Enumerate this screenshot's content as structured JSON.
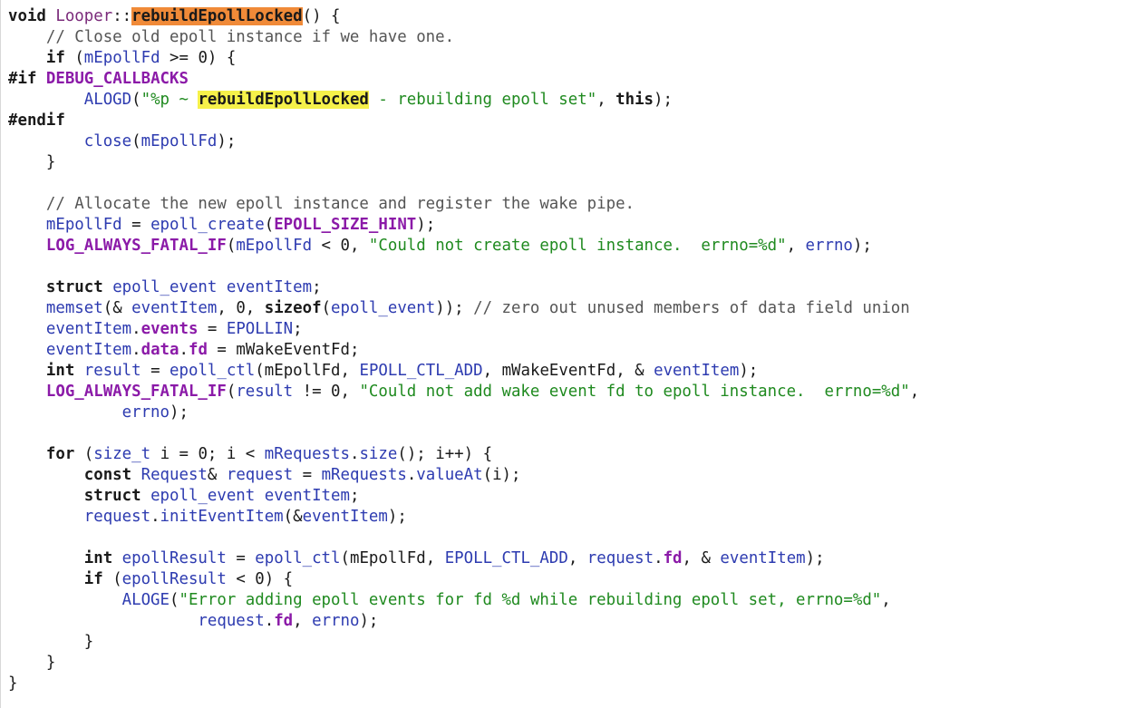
{
  "colors": {
    "plain": "#1a1a1a",
    "identifier": "#2d3bb0",
    "macro_member": "#8b1aa8",
    "string": "#1f8a1f",
    "comment": "#555555",
    "highlight_primary": "#f08a38",
    "highlight_secondary": "#f6f14a"
  },
  "lines": [
    {
      "tokens": [
        {
          "t": "void ",
          "c": "kw"
        },
        {
          "t": "Looper",
          "c": "cls"
        },
        {
          "t": "::",
          "c": "plain"
        },
        {
          "t": "rebuildEpollLocked",
          "c": "hl-orange"
        },
        {
          "t": "() {",
          "c": "plain"
        }
      ]
    },
    {
      "tokens": [
        {
          "t": "    // Close old epoll instance if we have one.",
          "c": "cmt"
        }
      ]
    },
    {
      "tokens": [
        {
          "t": "    ",
          "c": "plain"
        },
        {
          "t": "if",
          "c": "kw"
        },
        {
          "t": " (",
          "c": "plain"
        },
        {
          "t": "mEpollFd",
          "c": "ident"
        },
        {
          "t": " >= 0) {",
          "c": "plain"
        }
      ]
    },
    {
      "tokens": [
        {
          "t": "#if",
          "c": "pre"
        },
        {
          "t": " ",
          "c": "plain"
        },
        {
          "t": "DEBUG_CALLBACKS",
          "c": "macro"
        }
      ]
    },
    {
      "tokens": [
        {
          "t": "        ",
          "c": "plain"
        },
        {
          "t": "ALOGD",
          "c": "ident"
        },
        {
          "t": "(",
          "c": "plain"
        },
        {
          "t": "\"%p ~ ",
          "c": "str"
        },
        {
          "t": "rebuildEpollLocked",
          "c": "hl-yellow"
        },
        {
          "t": " - rebuilding epoll set\"",
          "c": "str"
        },
        {
          "t": ", ",
          "c": "plain"
        },
        {
          "t": "this",
          "c": "kw"
        },
        {
          "t": ");",
          "c": "plain"
        }
      ]
    },
    {
      "tokens": [
        {
          "t": "#endif",
          "c": "pre"
        }
      ]
    },
    {
      "tokens": [
        {
          "t": "        ",
          "c": "plain"
        },
        {
          "t": "close",
          "c": "ident"
        },
        {
          "t": "(",
          "c": "plain"
        },
        {
          "t": "mEpollFd",
          "c": "ident"
        },
        {
          "t": ");",
          "c": "plain"
        }
      ]
    },
    {
      "tokens": [
        {
          "t": "    }",
          "c": "plain"
        }
      ]
    },
    {
      "tokens": []
    },
    {
      "tokens": [
        {
          "t": "    // Allocate the new epoll instance and register the wake pipe.",
          "c": "cmt"
        }
      ]
    },
    {
      "tokens": [
        {
          "t": "    ",
          "c": "plain"
        },
        {
          "t": "mEpollFd",
          "c": "ident"
        },
        {
          "t": " = ",
          "c": "plain"
        },
        {
          "t": "epoll_create",
          "c": "ident"
        },
        {
          "t": "(",
          "c": "plain"
        },
        {
          "t": "EPOLL_SIZE_HINT",
          "c": "macro"
        },
        {
          "t": ");",
          "c": "plain"
        }
      ]
    },
    {
      "tokens": [
        {
          "t": "    ",
          "c": "plain"
        },
        {
          "t": "LOG_ALWAYS_FATAL_IF",
          "c": "macro"
        },
        {
          "t": "(",
          "c": "plain"
        },
        {
          "t": "mEpollFd",
          "c": "ident"
        },
        {
          "t": " < 0, ",
          "c": "plain"
        },
        {
          "t": "\"Could not create epoll instance.  errno=%d\"",
          "c": "str"
        },
        {
          "t": ", ",
          "c": "plain"
        },
        {
          "t": "errno",
          "c": "ident"
        },
        {
          "t": ");",
          "c": "plain"
        }
      ]
    },
    {
      "tokens": []
    },
    {
      "tokens": [
        {
          "t": "    ",
          "c": "plain"
        },
        {
          "t": "struct",
          "c": "kw"
        },
        {
          "t": " ",
          "c": "plain"
        },
        {
          "t": "epoll_event",
          "c": "type"
        },
        {
          "t": " ",
          "c": "plain"
        },
        {
          "t": "eventItem",
          "c": "ident"
        },
        {
          "t": ";",
          "c": "plain"
        }
      ]
    },
    {
      "tokens": [
        {
          "t": "    ",
          "c": "plain"
        },
        {
          "t": "memset",
          "c": "ident"
        },
        {
          "t": "(& ",
          "c": "plain"
        },
        {
          "t": "eventItem",
          "c": "ident"
        },
        {
          "t": ", 0, ",
          "c": "plain"
        },
        {
          "t": "sizeof",
          "c": "kw"
        },
        {
          "t": "(",
          "c": "plain"
        },
        {
          "t": "epoll_event",
          "c": "type"
        },
        {
          "t": ")); ",
          "c": "plain"
        },
        {
          "t": "// zero out unused members of data field union",
          "c": "cmt"
        }
      ]
    },
    {
      "tokens": [
        {
          "t": "    ",
          "c": "plain"
        },
        {
          "t": "eventItem",
          "c": "ident"
        },
        {
          "t": ".",
          "c": "plain"
        },
        {
          "t": "events",
          "c": "member"
        },
        {
          "t": " = ",
          "c": "plain"
        },
        {
          "t": "EPOLLIN",
          "c": "ident"
        },
        {
          "t": ";",
          "c": "plain"
        }
      ]
    },
    {
      "tokens": [
        {
          "t": "    ",
          "c": "plain"
        },
        {
          "t": "eventItem",
          "c": "ident"
        },
        {
          "t": ".",
          "c": "plain"
        },
        {
          "t": "data",
          "c": "member"
        },
        {
          "t": ".",
          "c": "plain"
        },
        {
          "t": "fd",
          "c": "member"
        },
        {
          "t": " = ",
          "c": "plain"
        },
        {
          "t": "mWakeEventFd",
          "c": "plain"
        },
        {
          "t": ";",
          "c": "plain"
        }
      ]
    },
    {
      "tokens": [
        {
          "t": "    ",
          "c": "plain"
        },
        {
          "t": "int",
          "c": "kw"
        },
        {
          "t": " ",
          "c": "plain"
        },
        {
          "t": "result",
          "c": "ident"
        },
        {
          "t": " = ",
          "c": "plain"
        },
        {
          "t": "epoll_ctl",
          "c": "ident"
        },
        {
          "t": "(",
          "c": "plain"
        },
        {
          "t": "mEpollFd",
          "c": "plain"
        },
        {
          "t": ", ",
          "c": "plain"
        },
        {
          "t": "EPOLL_CTL_ADD",
          "c": "ident"
        },
        {
          "t": ", ",
          "c": "plain"
        },
        {
          "t": "mWakeEventFd",
          "c": "plain"
        },
        {
          "t": ", & ",
          "c": "plain"
        },
        {
          "t": "eventItem",
          "c": "ident"
        },
        {
          "t": ");",
          "c": "plain"
        }
      ]
    },
    {
      "tokens": [
        {
          "t": "    ",
          "c": "plain"
        },
        {
          "t": "LOG_ALWAYS_FATAL_IF",
          "c": "macro"
        },
        {
          "t": "(",
          "c": "plain"
        },
        {
          "t": "result",
          "c": "ident"
        },
        {
          "t": " != 0, ",
          "c": "plain"
        },
        {
          "t": "\"Could not add wake event fd to epoll instance.  errno=%d\"",
          "c": "str"
        },
        {
          "t": ",",
          "c": "plain"
        }
      ]
    },
    {
      "tokens": [
        {
          "t": "            ",
          "c": "plain"
        },
        {
          "t": "errno",
          "c": "ident"
        },
        {
          "t": ");",
          "c": "plain"
        }
      ]
    },
    {
      "tokens": []
    },
    {
      "tokens": [
        {
          "t": "    ",
          "c": "plain"
        },
        {
          "t": "for",
          "c": "kw"
        },
        {
          "t": " (",
          "c": "plain"
        },
        {
          "t": "size_t",
          "c": "type"
        },
        {
          "t": " i = 0; i < ",
          "c": "plain"
        },
        {
          "t": "mRequests",
          "c": "ident"
        },
        {
          "t": ".",
          "c": "plain"
        },
        {
          "t": "size",
          "c": "ident"
        },
        {
          "t": "(); i++) {",
          "c": "plain"
        }
      ]
    },
    {
      "tokens": [
        {
          "t": "        ",
          "c": "plain"
        },
        {
          "t": "const",
          "c": "kw"
        },
        {
          "t": " ",
          "c": "plain"
        },
        {
          "t": "Request",
          "c": "type"
        },
        {
          "t": "& ",
          "c": "plain"
        },
        {
          "t": "request",
          "c": "ident"
        },
        {
          "t": " = ",
          "c": "plain"
        },
        {
          "t": "mRequests",
          "c": "ident"
        },
        {
          "t": ".",
          "c": "plain"
        },
        {
          "t": "valueAt",
          "c": "ident"
        },
        {
          "t": "(i);",
          "c": "plain"
        }
      ]
    },
    {
      "tokens": [
        {
          "t": "        ",
          "c": "plain"
        },
        {
          "t": "struct",
          "c": "kw"
        },
        {
          "t": " ",
          "c": "plain"
        },
        {
          "t": "epoll_event",
          "c": "type"
        },
        {
          "t": " ",
          "c": "plain"
        },
        {
          "t": "eventItem",
          "c": "ident"
        },
        {
          "t": ";",
          "c": "plain"
        }
      ]
    },
    {
      "tokens": [
        {
          "t": "        ",
          "c": "plain"
        },
        {
          "t": "request",
          "c": "ident"
        },
        {
          "t": ".",
          "c": "plain"
        },
        {
          "t": "initEventItem",
          "c": "ident"
        },
        {
          "t": "(&",
          "c": "plain"
        },
        {
          "t": "eventItem",
          "c": "ident"
        },
        {
          "t": ");",
          "c": "plain"
        }
      ]
    },
    {
      "tokens": []
    },
    {
      "tokens": [
        {
          "t": "        ",
          "c": "plain"
        },
        {
          "t": "int",
          "c": "kw"
        },
        {
          "t": " ",
          "c": "plain"
        },
        {
          "t": "epollResult",
          "c": "ident"
        },
        {
          "t": " = ",
          "c": "plain"
        },
        {
          "t": "epoll_ctl",
          "c": "ident"
        },
        {
          "t": "(",
          "c": "plain"
        },
        {
          "t": "mEpollFd",
          "c": "plain"
        },
        {
          "t": ", ",
          "c": "plain"
        },
        {
          "t": "EPOLL_CTL_ADD",
          "c": "ident"
        },
        {
          "t": ", ",
          "c": "plain"
        },
        {
          "t": "request",
          "c": "ident"
        },
        {
          "t": ".",
          "c": "plain"
        },
        {
          "t": "fd",
          "c": "member"
        },
        {
          "t": ", & ",
          "c": "plain"
        },
        {
          "t": "eventItem",
          "c": "ident"
        },
        {
          "t": ");",
          "c": "plain"
        }
      ]
    },
    {
      "tokens": [
        {
          "t": "        ",
          "c": "plain"
        },
        {
          "t": "if",
          "c": "kw"
        },
        {
          "t": " (",
          "c": "plain"
        },
        {
          "t": "epollResult",
          "c": "ident"
        },
        {
          "t": " < 0) {",
          "c": "plain"
        }
      ]
    },
    {
      "tokens": [
        {
          "t": "            ",
          "c": "plain"
        },
        {
          "t": "ALOGE",
          "c": "ident"
        },
        {
          "t": "(",
          "c": "plain"
        },
        {
          "t": "\"Error adding epoll events for fd %d while rebuilding epoll set, errno=%d\"",
          "c": "str"
        },
        {
          "t": ",",
          "c": "plain"
        }
      ]
    },
    {
      "tokens": [
        {
          "t": "                    ",
          "c": "plain"
        },
        {
          "t": "request",
          "c": "ident"
        },
        {
          "t": ".",
          "c": "plain"
        },
        {
          "t": "fd",
          "c": "member"
        },
        {
          "t": ", ",
          "c": "plain"
        },
        {
          "t": "errno",
          "c": "ident"
        },
        {
          "t": ");",
          "c": "plain"
        }
      ]
    },
    {
      "tokens": [
        {
          "t": "        }",
          "c": "plain"
        }
      ]
    },
    {
      "tokens": [
        {
          "t": "    }",
          "c": "plain"
        }
      ]
    },
    {
      "tokens": [
        {
          "t": "}",
          "c": "plain"
        }
      ]
    }
  ]
}
